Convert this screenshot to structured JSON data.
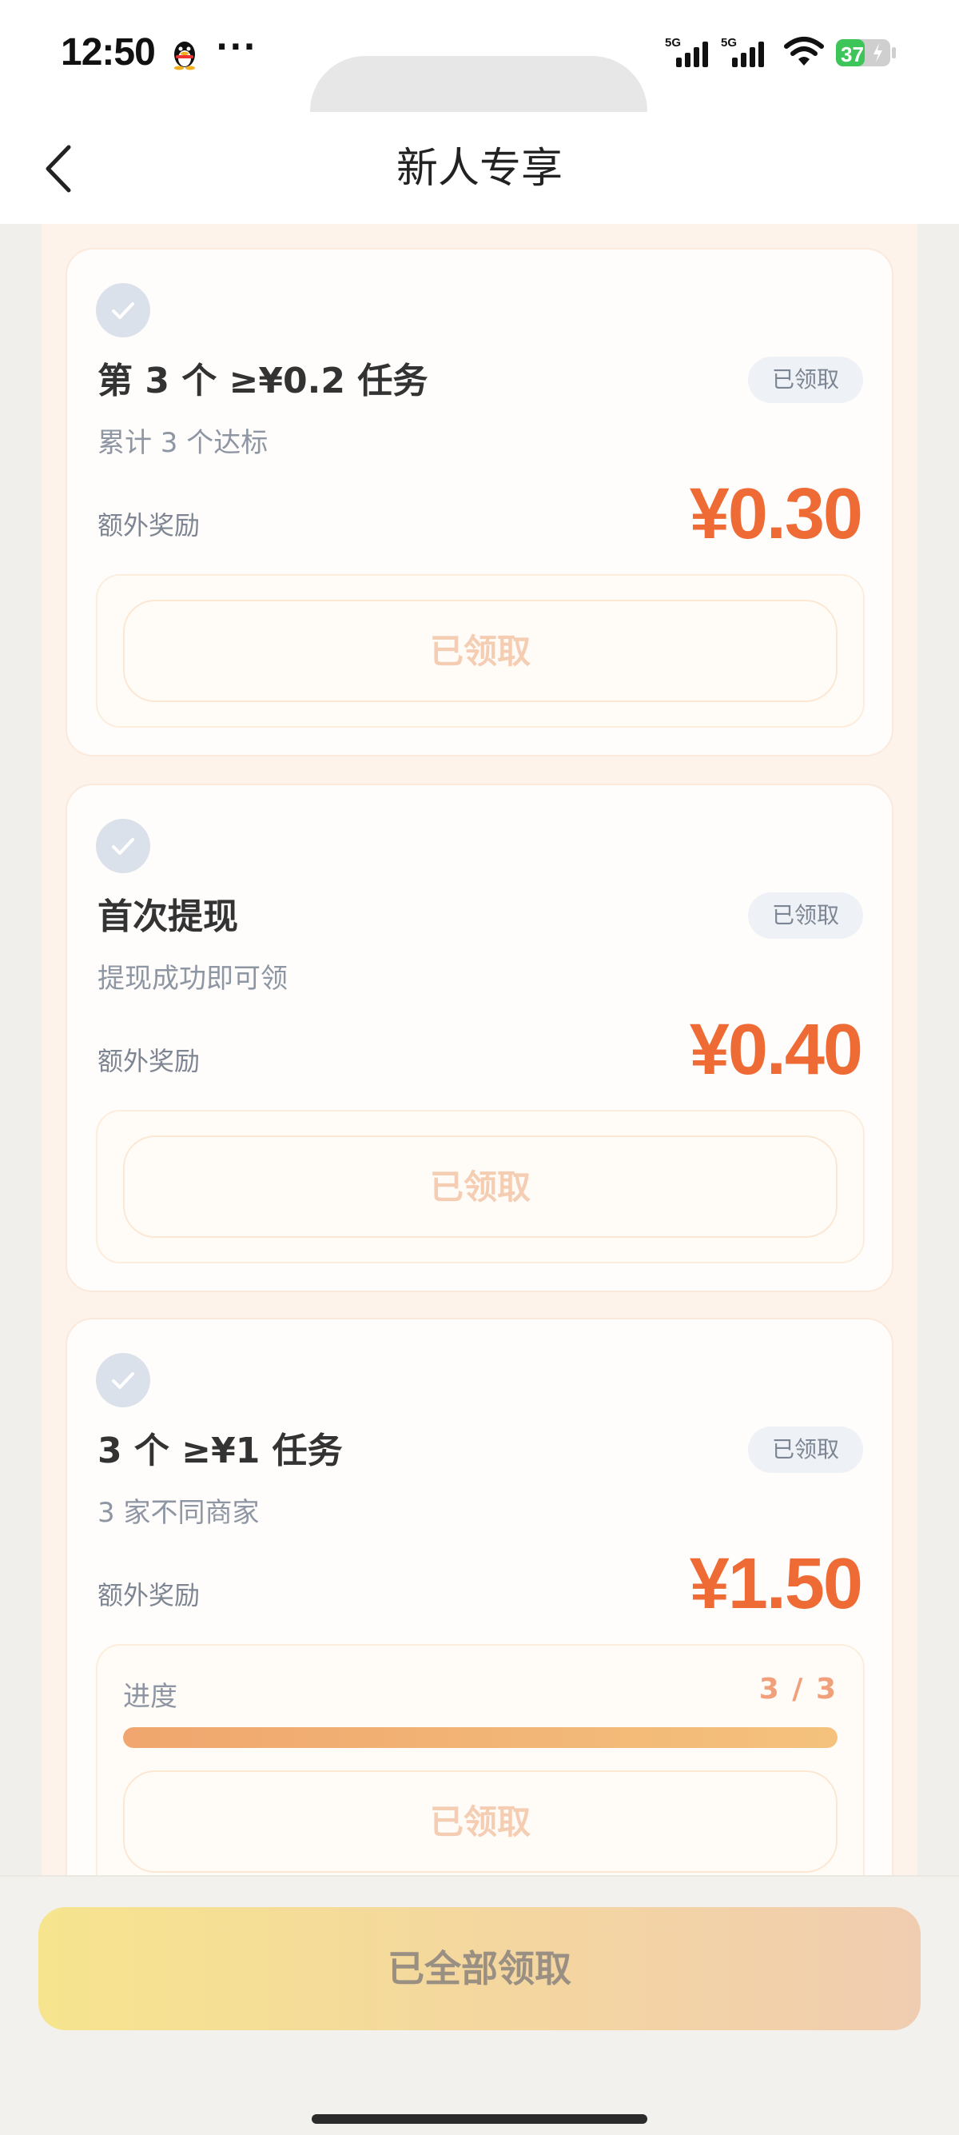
{
  "status_bar": {
    "time": "12:50",
    "dots": "···",
    "signal_labels": [
      "5G",
      "5G"
    ],
    "battery": "37"
  },
  "nav": {
    "title": "新人专享"
  },
  "tasks": [
    {
      "title": "第 3 个 ≥¥0.2 任务",
      "subtitle": "累计 3 个达标",
      "badge": "已领取",
      "reward_label": "额外奖励",
      "reward_amount": "¥0.30",
      "button_label": "已领取"
    },
    {
      "title": "首次提现",
      "subtitle": "提现成功即可领",
      "badge": "已领取",
      "reward_label": "额外奖励",
      "reward_amount": "¥0.40",
      "button_label": "已领取"
    },
    {
      "title": "3 个 ≥¥1 任务",
      "subtitle": "3 家不同商家",
      "badge": "已领取",
      "reward_label": "额外奖励",
      "reward_amount": "¥1.50",
      "progress_label": "进度",
      "progress_text": "3 / 3",
      "progress_fraction": 1.0,
      "button_label": "已领取"
    }
  ],
  "bottom": {
    "claim_all_label": "已全部领取"
  },
  "colors": {
    "accent": "#ee6b35",
    "badge_bg": "#eef1f5",
    "check_bg": "#dbe1ea"
  },
  "icons": {
    "back": "chevron-left-icon",
    "check": "check-icon",
    "qq": "qq-penguin-icon",
    "wifi": "wifi-icon",
    "battery": "battery-icon",
    "signal": "signal-icon"
  }
}
